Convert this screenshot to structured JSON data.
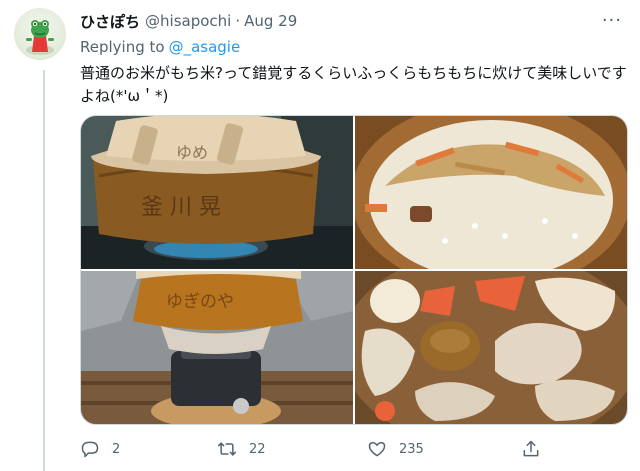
{
  "tweet": {
    "display_name": "ひさぽち",
    "handle": "@hisapochi",
    "separator": "·",
    "date": "Aug 29",
    "more": "···",
    "replying_prefix": "Replying to",
    "replying_to": "@_asagie",
    "text": "普通のお米がもち米?って錯覚するくらいふっくらもちもちに炊けて美味しいですよね(*'ω＇*)",
    "photo_text_1": "ゆめ",
    "photo_text_2": "釜 川 晃",
    "photo_text_3": "ゆぎのや",
    "actions": {
      "reply_count": "2",
      "retweet_count": "22",
      "like_count": "235"
    },
    "icons": [
      "frog-avatar",
      "more-icon",
      "reply-icon",
      "retweet-icon",
      "like-icon",
      "share-icon"
    ],
    "colors": {
      "link": "#1d9bf0",
      "secondary_text": "#536471",
      "thread_line": "#cfd9de"
    }
  }
}
